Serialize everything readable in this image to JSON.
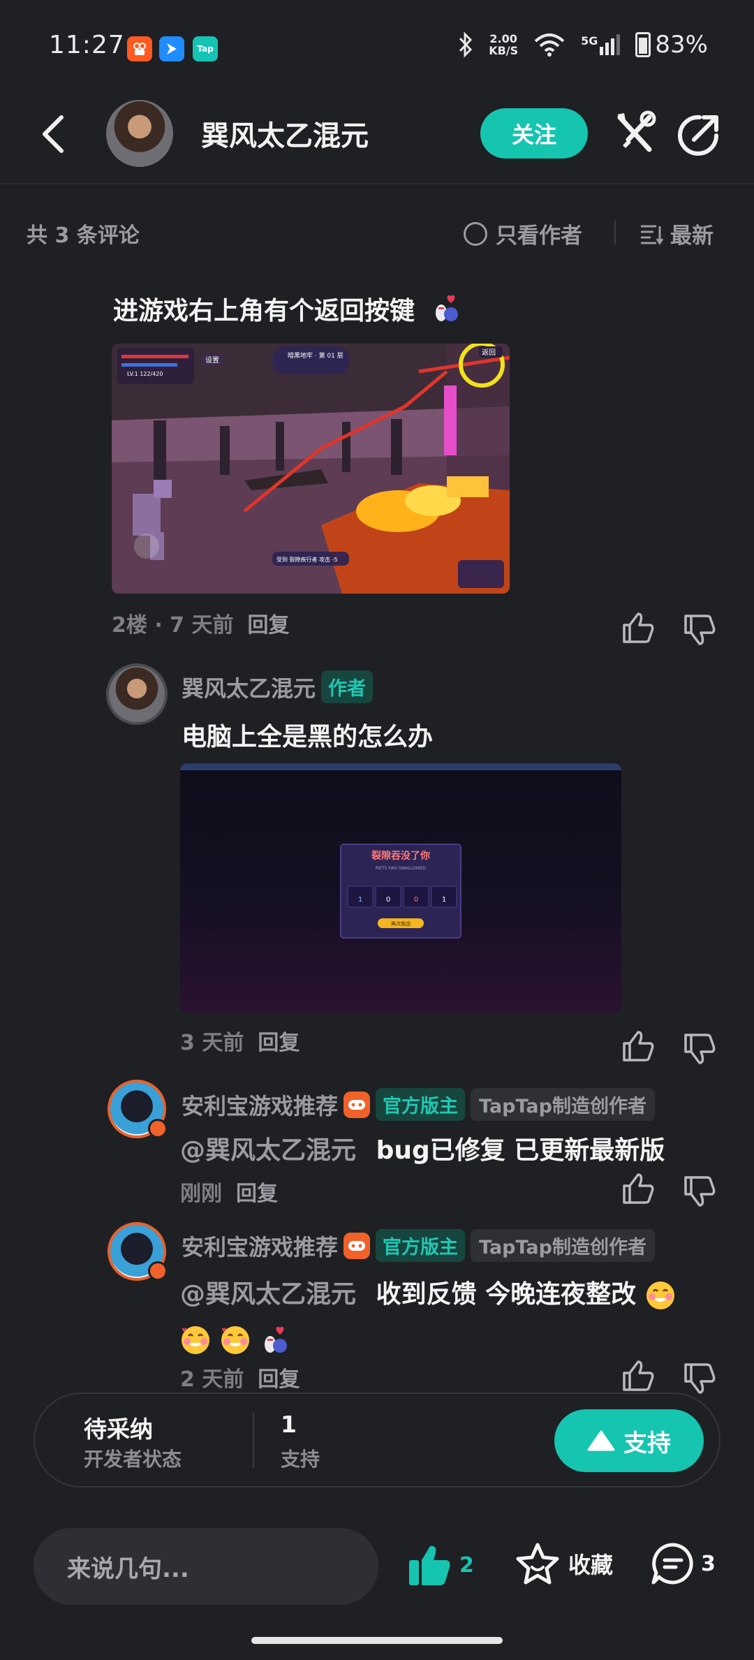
{
  "status_bar": {
    "time": "11:27",
    "net_speed": "2.00",
    "net_unit": "KB/S",
    "signal": "5G",
    "battery": "83%"
  },
  "header": {
    "username": "巽风太乙混元",
    "follow_label": "关注"
  },
  "comments_bar": {
    "count_label": "共 3 条评论",
    "author_only_label": "只看作者",
    "sort_label": "最新"
  },
  "floor2": {
    "text": "进游戏右上角有个返回按键",
    "image1": {
      "top_text": "暗黑地牢 · 第 01 层",
      "settings": "设置",
      "back": "返回",
      "hud_line": "LV.1 122/420",
      "bottom_text": "受到 裂隙疾行者 攻击 -5"
    },
    "meta": "2楼 · 7 天前",
    "reply_label": "回复"
  },
  "reply1": {
    "name": "巽风太乙混元",
    "badge": "作者",
    "text": "电脑上全是黑的怎么办",
    "image2": {
      "dialog_title": "裂隙吞没了你",
      "dialog_sub": "RIFTS HAS SWALLOWED",
      "stats": [
        "1",
        "0",
        "0",
        "1"
      ],
      "btn": "再次挑战"
    },
    "meta": "3 天前",
    "reply_label": "回复"
  },
  "reply2": {
    "name": "安利宝游戏推荐",
    "badge_official": "官方版主",
    "badge_creator": "TapTap制造创作者",
    "mention": "@巽风太乙混元",
    "text": "bug已修复 已更新最新版",
    "meta": "刚刚",
    "reply_label": "回复"
  },
  "reply3": {
    "name": "安利宝游戏推荐",
    "badge_official": "官方版主",
    "badge_creator": "TapTap制造创作者",
    "mention": "@巽风太乙混元",
    "text": "收到反馈 今晚连夜整改",
    "meta": "2 天前",
    "reply_label": "回复"
  },
  "status_card": {
    "dev_status": "待采纳",
    "dev_status_label": "开发者状态",
    "support_count": "1",
    "support_label": "支持",
    "support_btn": "支持"
  },
  "bottom_bar": {
    "input_placeholder": "来说几句...",
    "like_count": "2",
    "fav_label": "收藏",
    "comment_count": "3"
  },
  "colors": {
    "accent": "#15c5b0",
    "bg": "#1f2024"
  }
}
